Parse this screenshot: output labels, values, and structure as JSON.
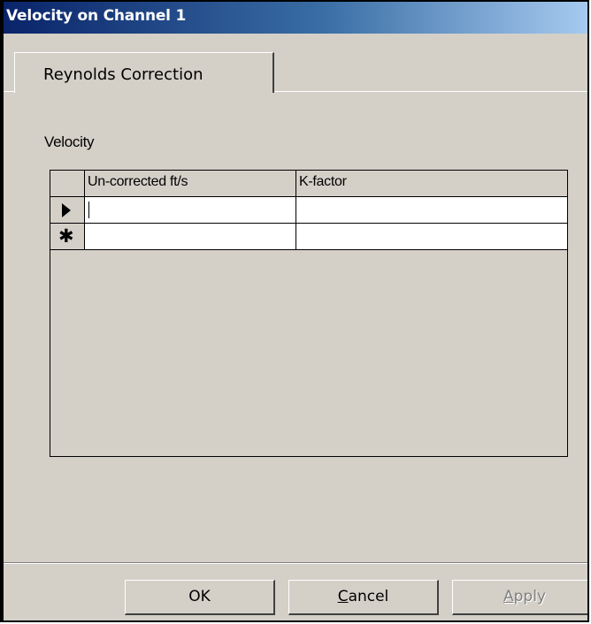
{
  "window": {
    "title": "Velocity on Channel 1"
  },
  "tabs": [
    {
      "label": "Reynolds Correction",
      "active": true
    }
  ],
  "section": {
    "label": "Velocity"
  },
  "grid": {
    "columns": [
      "Un-corrected ft/s",
      "K-factor"
    ],
    "rows": [
      {
        "selector_icon": "current-row-arrow-icon",
        "values": [
          "",
          ""
        ]
      },
      {
        "selector_icon": "new-row-star-icon",
        "values": [
          "",
          ""
        ]
      }
    ]
  },
  "buttons": {
    "ok": {
      "label": "OK"
    },
    "cancel": {
      "access_key": "C",
      "rest": "ancel"
    },
    "apply": {
      "access_key": "A",
      "rest": "pply",
      "enabled": false
    }
  }
}
